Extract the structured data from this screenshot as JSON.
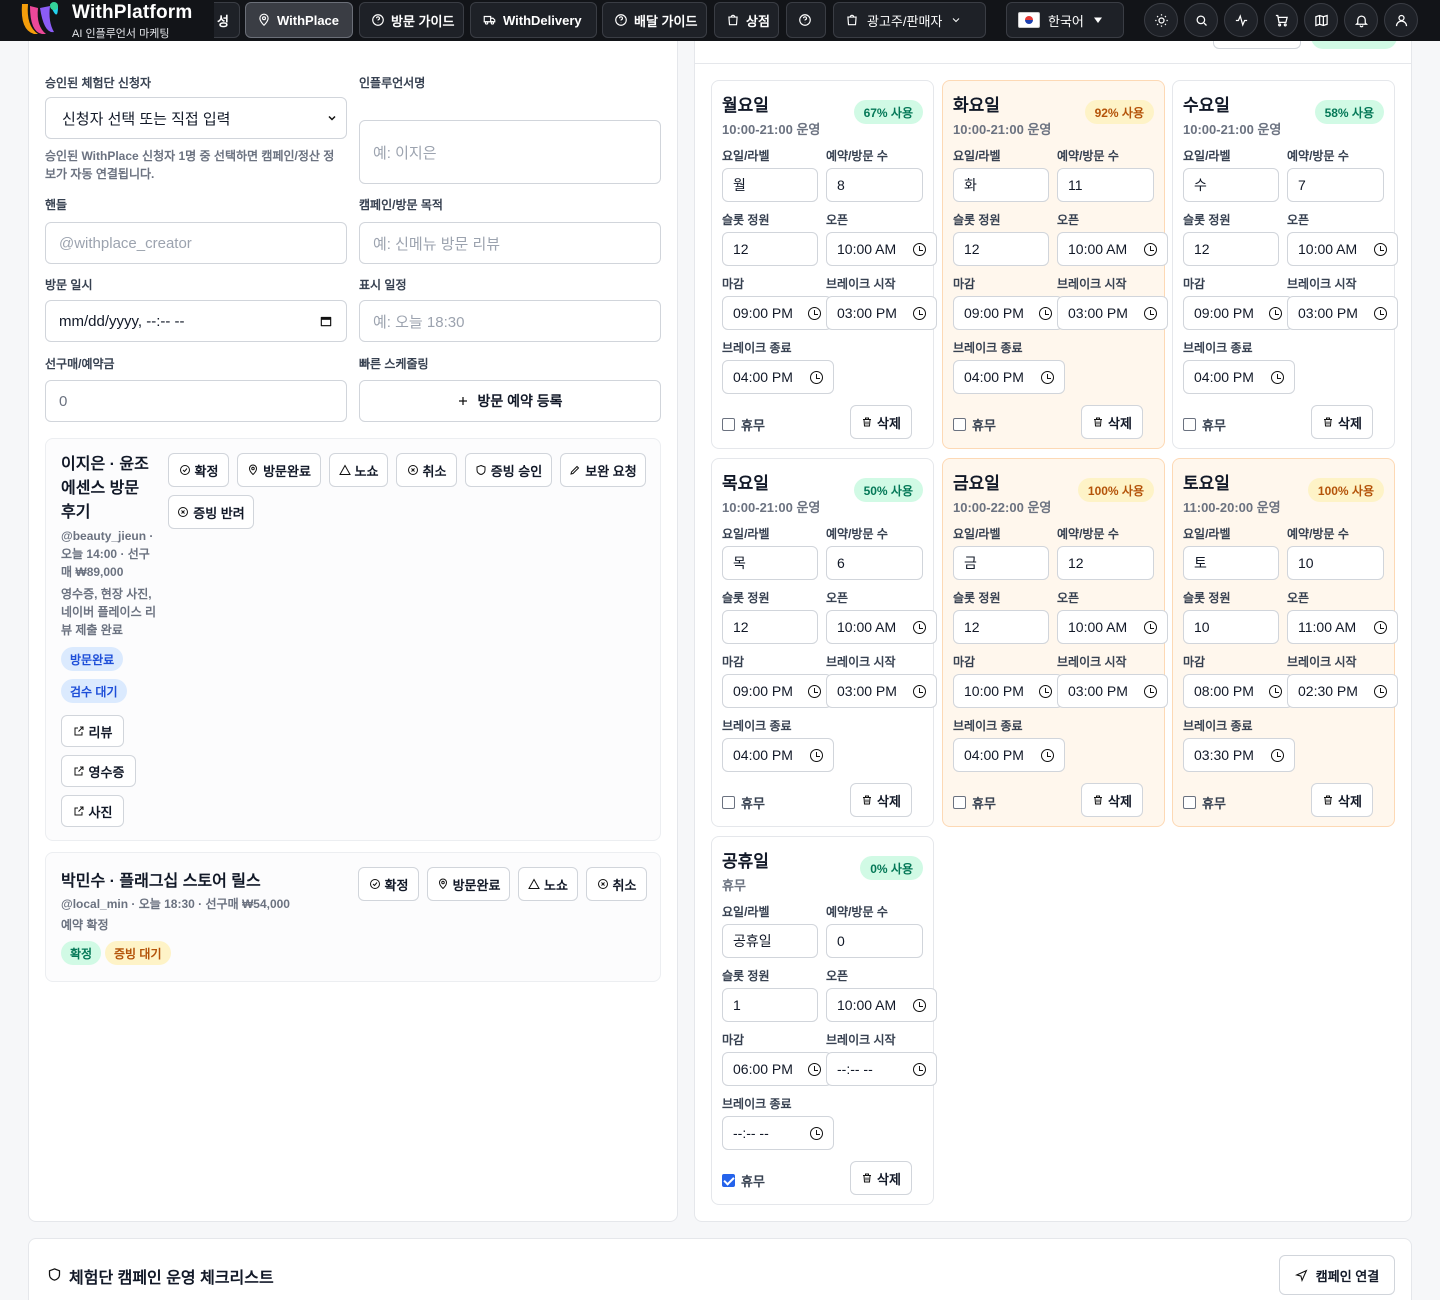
{
  "brand": {
    "name": "WithPlatform",
    "subtitle": "AI 인플루언서 마케팅"
  },
  "nav": {
    "items": [
      {
        "label": "성"
      },
      {
        "label": "WithPlace",
        "active": true
      },
      {
        "label": "방문 가이드"
      },
      {
        "label": "WithDelivery"
      },
      {
        "label": "배달 가이드"
      },
      {
        "label": "상점"
      },
      {
        "label": ""
      }
    ],
    "role_select": "광고주/판매자",
    "language": "한국어",
    "icons": [
      "sun-icon",
      "search-icon",
      "activity-icon",
      "cart-icon",
      "map-icon",
      "bell-icon",
      "user-icon"
    ]
  },
  "booking_form": {
    "applicant_label": "승인된 체험단 신청자",
    "applicant_select": "신청자 선택 또는 직접 입력",
    "applicant_hint": "승인된 WithPlace 신청자 1명 중 선택하면 캠페인/정산 정보가 자동 연결됩니다.",
    "influencer_label": "인플루언서명",
    "influencer_placeholder": "예: 이지은",
    "handle_label": "핸들",
    "handle_placeholder": "@withplace_creator",
    "purpose_label": "캠페인/방문 목적",
    "purpose_placeholder": "예: 신메뉴 방문 리뷰",
    "visit_label": "방문 일시",
    "visit_placeholder": "mm/dd/yyyy, --:-- --",
    "display_label": "표시 일정",
    "display_placeholder": "예: 오늘 18:30",
    "deposit_label": "선구매/예약금",
    "deposit_value": "0",
    "quick_label": "빠른 스케줄링",
    "quick_button": "방문 예약 등록"
  },
  "reservations": [
    {
      "title": "이지은 · 윤조에센스 방문 후기",
      "meta": "@beauty_jieun · 오늘 14:00 · 선구매 ₩89,000",
      "note": "영수증, 현장 사진, 네이버 플레이스 리뷰 제출 완료",
      "badges": [
        "방문완료",
        "검수 대기"
      ],
      "actions": [
        "확정",
        "방문완료",
        "노쇼",
        "취소",
        "증빙 승인",
        "보완 요청",
        "증빙 반려"
      ],
      "links": [
        "리뷰",
        "영수증",
        "사진"
      ]
    },
    {
      "title": "박민수 · 플래그십 스토어 릴스",
      "meta": "@local_min · 오늘 18:30 · 선구매 ₩54,000",
      "note": "예약 확정",
      "badges": [
        "확정",
        "증빙 대기"
      ],
      "actions": [
        "확정",
        "방문완료",
        "노쇼",
        "취소"
      ]
    }
  ],
  "schedule": {
    "labels": {
      "label": "요일/라벨",
      "count": "예약/방문 수",
      "capacity": "슬롯 정원",
      "open": "오픈",
      "close": "마감",
      "break_start": "브레이크 시작",
      "break_end": "브레이크 종료",
      "closed": "휴무",
      "delete": "삭제"
    },
    "days": [
      {
        "name": "월요일",
        "hours": "10:00-21:00 운영",
        "usage": "67% 사용",
        "label": "월",
        "count": "8",
        "capacity": "12",
        "open": "10:00 AM",
        "close": "09:00 PM",
        "break_start": "03:00 PM",
        "break_end": "04:00 PM",
        "closed": false,
        "warn": false
      },
      {
        "name": "화요일",
        "hours": "10:00-21:00 운영",
        "usage": "92% 사용",
        "label": "화",
        "count": "11",
        "capacity": "12",
        "open": "10:00 AM",
        "close": "09:00 PM",
        "break_start": "03:00 PM",
        "break_end": "04:00 PM",
        "closed": false,
        "warn": true
      },
      {
        "name": "수요일",
        "hours": "10:00-21:00 운영",
        "usage": "58% 사용",
        "label": "수",
        "count": "7",
        "capacity": "12",
        "open": "10:00 AM",
        "close": "09:00 PM",
        "break_start": "03:00 PM",
        "break_end": "04:00 PM",
        "closed": false,
        "warn": false
      },
      {
        "name": "목요일",
        "hours": "10:00-21:00 운영",
        "usage": "50% 사용",
        "label": "목",
        "count": "6",
        "capacity": "12",
        "open": "10:00 AM",
        "close": "09:00 PM",
        "break_start": "03:00 PM",
        "break_end": "04:00 PM",
        "closed": false,
        "warn": false
      },
      {
        "name": "금요일",
        "hours": "10:00-22:00 운영",
        "usage": "100% 사용",
        "label": "금",
        "count": "12",
        "capacity": "12",
        "open": "10:00 AM",
        "close": "10:00 PM",
        "break_start": "03:00 PM",
        "break_end": "04:00 PM",
        "closed": false,
        "warn": true
      },
      {
        "name": "토요일",
        "hours": "11:00-20:00 운영",
        "usage": "100% 사용",
        "label": "토",
        "count": "10",
        "capacity": "10",
        "open": "11:00 AM",
        "close": "08:00 PM",
        "break_start": "02:30 PM",
        "break_end": "03:30 PM",
        "closed": false,
        "warn": true
      },
      {
        "name": "공휴일",
        "hours": "휴무",
        "usage": "0% 사용",
        "label": "공휴일",
        "count": "0",
        "capacity": "1",
        "open": "10:00 AM",
        "close": "06:00 PM",
        "break_start": "--:-- --",
        "break_end": "--:-- --",
        "closed": true,
        "warn": false
      }
    ]
  },
  "checklist": {
    "title": "체험단 캠페인 운영 체크리스트",
    "button": "캠페인 연결"
  },
  "colors": {
    "accent": "#2563eb",
    "warn_bg": "#fff7ed",
    "nav_bg": "#121418"
  }
}
